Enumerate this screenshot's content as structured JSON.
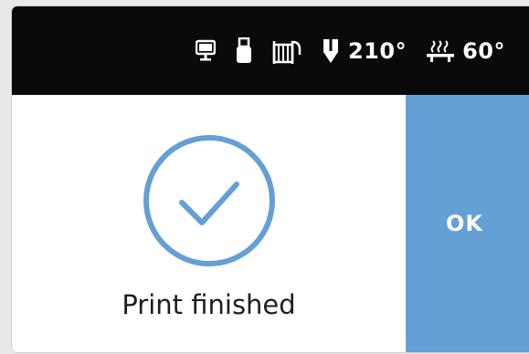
{
  "status_bar": {
    "icons": [
      "monitor-icon",
      "usb-drive-icon",
      "filament-spool-icon"
    ],
    "nozzle": {
      "icon": "nozzle-icon",
      "temperature": "210°"
    },
    "bed": {
      "icon": "heated-bed-icon",
      "temperature": "60°"
    }
  },
  "dialog": {
    "icon": "checkmark-circle-icon",
    "message": "Print finished",
    "ok_label": "OK"
  },
  "colors": {
    "status_bar_bg": "#0a0a0a",
    "accent": "#649fd6",
    "text": "#1e1e1e"
  }
}
